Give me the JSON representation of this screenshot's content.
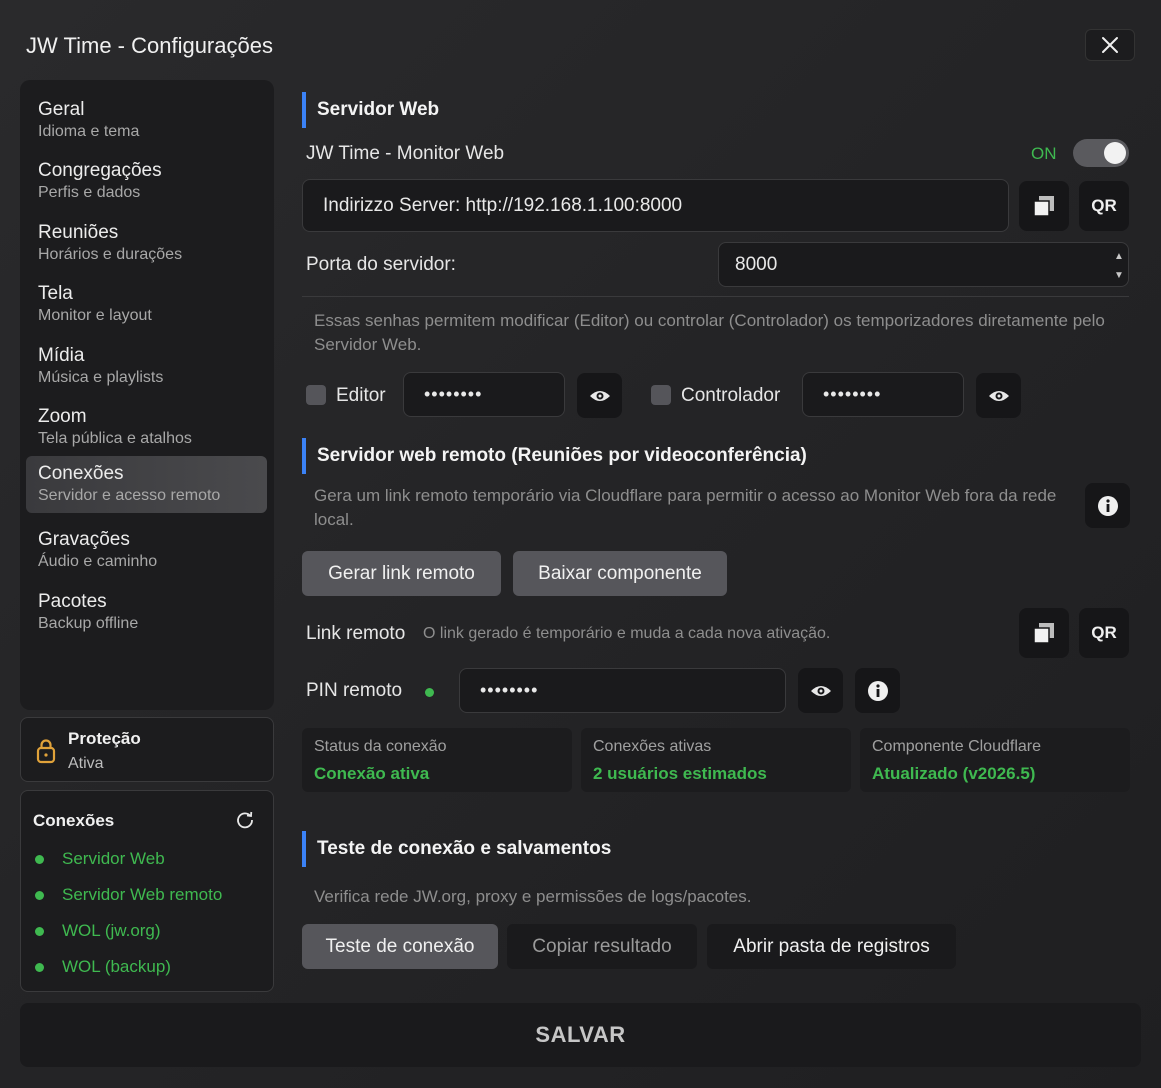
{
  "window": {
    "title": "JW Time - Configurações"
  },
  "sidebar": {
    "items": [
      {
        "title": "Geral",
        "sub": "Idioma e tema"
      },
      {
        "title": "Congregações",
        "sub": "Perfis e dados"
      },
      {
        "title": "Reuniões",
        "sub": "Horários e durações"
      },
      {
        "title": "Tela",
        "sub": "Monitor e layout"
      },
      {
        "title": "Mídia",
        "sub": "Música e playlists"
      },
      {
        "title": "Zoom",
        "sub": "Tela pública e atalhos"
      },
      {
        "title": "Conexões",
        "sub": "Servidor e acesso remoto",
        "active": true
      },
      {
        "title": "Gravações",
        "sub": "Áudio e caminho"
      },
      {
        "title": "Pacotes",
        "sub": "Backup offline"
      }
    ]
  },
  "protection": {
    "title": "Proteção",
    "status": "Ativa"
  },
  "connections": {
    "title": "Conexões",
    "items": [
      "Servidor Web",
      "Servidor Web remoto",
      "WOL (jw.org)",
      "WOL (backup)"
    ],
    "status_color": "#3fb950"
  },
  "web_server": {
    "section_title": "Servidor Web",
    "monitor_label": "JW Time - Monitor Web",
    "toggle_label": "ON",
    "address_text": "Indirizzo Server: http://192.168.1.100:8000",
    "qr_label": "QR",
    "port_label": "Porta do servidor:",
    "port_value": "8000",
    "password_help": "Essas senhas permitem modificar (Editor) ou controlar (Controlador) os temporizadores diretamente pelo Servidor Web.",
    "editor_label": "Editor",
    "editor_password": "••••••••",
    "controller_label": "Controlador",
    "controller_password": "••••••••"
  },
  "remote": {
    "section_title": "Servidor web remoto (Reuniões por videoconferência)",
    "help": "Gera um link remoto temporário via Cloudflare para permitir o acesso ao Monitor Web fora da rede local.",
    "generate_btn": "Gerar link remoto",
    "download_btn": "Baixar componente",
    "link_label": "Link remoto",
    "link_hint": "O link gerado é temporário e muda a cada nova ativação.",
    "qr_label": "QR",
    "pin_label": "PIN remoto",
    "pin_value": "••••••••",
    "status": [
      {
        "label": "Status da conexão",
        "value": "Conexão ativa"
      },
      {
        "label": "Conexões ativas",
        "value": "2 usuários estimados"
      },
      {
        "label": "Componente Cloudflare",
        "value": "Atualizado (v2026.5)"
      }
    ]
  },
  "test": {
    "section_title": "Teste de conexão e salvamentos",
    "help": "Verifica rede JW.org, proxy e permissões de logs/pacotes.",
    "test_btn": "Teste de conexão",
    "copy_btn": "Copiar resultado",
    "open_btn": "Abrir pasta de registros"
  },
  "footer": {
    "save_label": "SALVAR"
  },
  "colors": {
    "accent": "#3b82f6",
    "success": "#3fb950"
  }
}
